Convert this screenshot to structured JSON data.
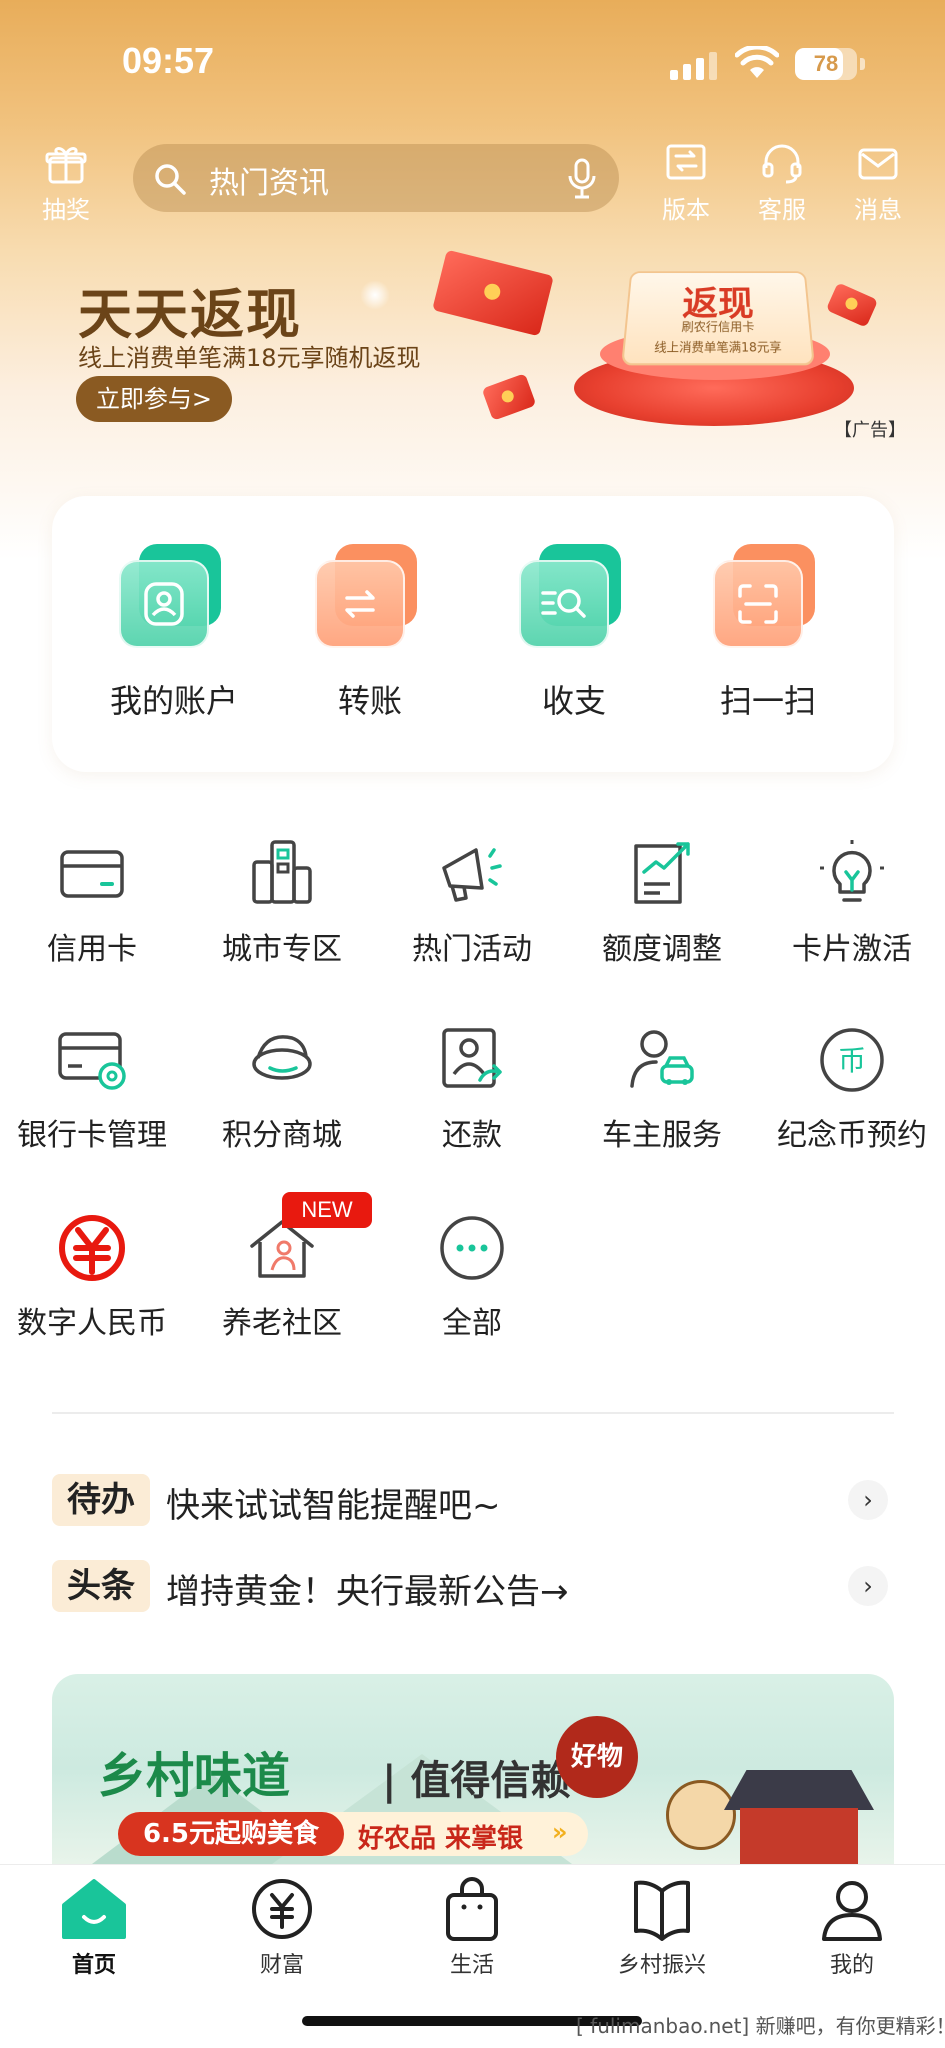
{
  "status_bar": {
    "time": "09:57",
    "battery": "78",
    "battery_level": 0.78
  },
  "toolbar": {
    "lottery": "抽奖",
    "search_placeholder": "热门资讯",
    "version": "版本",
    "service": "客服",
    "messages": "消息"
  },
  "banner": {
    "title": "天天返现",
    "subtitle": "线上消费单笔满18元享随机返现",
    "button": "立即参与>",
    "ad_tag": "【广告】",
    "card_big": "返现",
    "card_line1": "刷农行信用卡",
    "card_line2": "线上消费单笔满18元享"
  },
  "main_actions": [
    {
      "label": "我的账户",
      "icon": "account-icon",
      "color": "green"
    },
    {
      "label": "转账",
      "icon": "transfer-icon",
      "color": "orange"
    },
    {
      "label": "收支",
      "icon": "statement-icon",
      "color": "green"
    },
    {
      "label": "扫一扫",
      "icon": "scan-icon",
      "color": "orange"
    }
  ],
  "grid": [
    {
      "label": "信用卡",
      "icon": "credit-card-icon"
    },
    {
      "label": "城市专区",
      "icon": "city-icon"
    },
    {
      "label": "热门活动",
      "icon": "megaphone-icon"
    },
    {
      "label": "额度调整",
      "icon": "limit-chart-icon"
    },
    {
      "label": "卡片激活",
      "icon": "lightbulb-icon"
    },
    {
      "label": "银行卡管理",
      "icon": "card-settings-icon"
    },
    {
      "label": "积分商城",
      "icon": "points-icon"
    },
    {
      "label": "还款",
      "icon": "repay-icon"
    },
    {
      "label": "车主服务",
      "icon": "car-owner-icon"
    },
    {
      "label": "纪念币预约",
      "icon": "coin-icon"
    },
    {
      "label": "数字人民币",
      "icon": "digital-rmb-icon"
    },
    {
      "label": "养老社区",
      "icon": "elderly-home-icon",
      "badge": "NEW"
    },
    {
      "label": "全部",
      "icon": "more-icon"
    }
  ],
  "notices": [
    {
      "tag": "待办",
      "text": "快来试试智能提醒吧~"
    },
    {
      "tag": "头条",
      "text": "增持黄金！央行最新公告→"
    }
  ],
  "promo": {
    "title": "乡村味道",
    "title2": "| 值得信赖",
    "seal": "好物",
    "strip_red": "6.5元起购美食",
    "strip_rest": "好农品 来掌银",
    "strip_chevron": "»"
  },
  "tabs": [
    {
      "label": "首页",
      "icon": "home-icon",
      "active": true
    },
    {
      "label": "财富",
      "icon": "wealth-icon"
    },
    {
      "label": "生活",
      "icon": "life-bag-icon"
    },
    {
      "label": "乡村振兴",
      "icon": "rural-book-icon"
    },
    {
      "label": "我的",
      "icon": "profile-icon"
    }
  ],
  "watermark": "[ fulimanbao.net] 新赚吧，有你更精彩！",
  "colors": {
    "accent_green": "#19c59a",
    "accent_orange": "#fb9060",
    "brand_gold": "#e8ad5a",
    "red": "#e8190f"
  }
}
